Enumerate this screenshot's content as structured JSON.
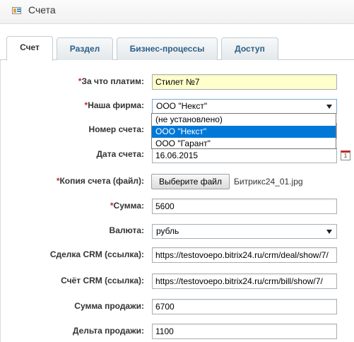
{
  "window": {
    "title": "Счета",
    "icon": "invoice-list-icon"
  },
  "tabs": [
    {
      "label": "Счет",
      "active": true
    },
    {
      "label": "Раздел",
      "active": false
    },
    {
      "label": "Бизнес-процессы",
      "active": false
    },
    {
      "label": "Доступ",
      "active": false
    }
  ],
  "form": {
    "payment_for": {
      "label": "За что платим:",
      "required_mark": "*",
      "value": "Стилет №7"
    },
    "company": {
      "label": "Наша фирма:",
      "required_mark": "*",
      "value": "ООО \"Некст\"",
      "options": [
        "(не установлено)",
        "ООО \"Некст\"",
        "ООО \"Гарант\""
      ],
      "highlighted": "ООО \"Некст\""
    },
    "invoice_number": {
      "label": "Номер счета:",
      "value": ""
    },
    "invoice_date": {
      "label": "Дата счета:",
      "value": "16.06.2015",
      "calendar_icon": "calendar-icon",
      "calendar_digit": "1"
    },
    "invoice_copy": {
      "label": "Копия счета (файл):",
      "required_mark": "*",
      "button_label": "Выберите файл",
      "file_name": "Битрикс24_01.jpg"
    },
    "amount": {
      "label": "Сумма:",
      "required_mark": "*",
      "value": "5600"
    },
    "currency": {
      "label": "Валюта:",
      "value": "рубль"
    },
    "crm_deal": {
      "label": "Сделка CRM (ссылка):",
      "value": "https://testovoepo.bitrix24.ru/crm/deal/show/7/"
    },
    "crm_bill": {
      "label": "Счёт CRM (ссылка):",
      "value": "https://testovoepo.bitrix24.ru/crm/bill/show/7/"
    },
    "sale_amount": {
      "label": "Сумма продажи:",
      "value": "6700"
    },
    "sale_delta": {
      "label": "Дельта продажи:",
      "value": "1100"
    }
  },
  "colors": {
    "accent": "#2d5e86",
    "required": "#c62828",
    "highlight_field": "#ffffcc",
    "selected_option": "#0078d7"
  }
}
